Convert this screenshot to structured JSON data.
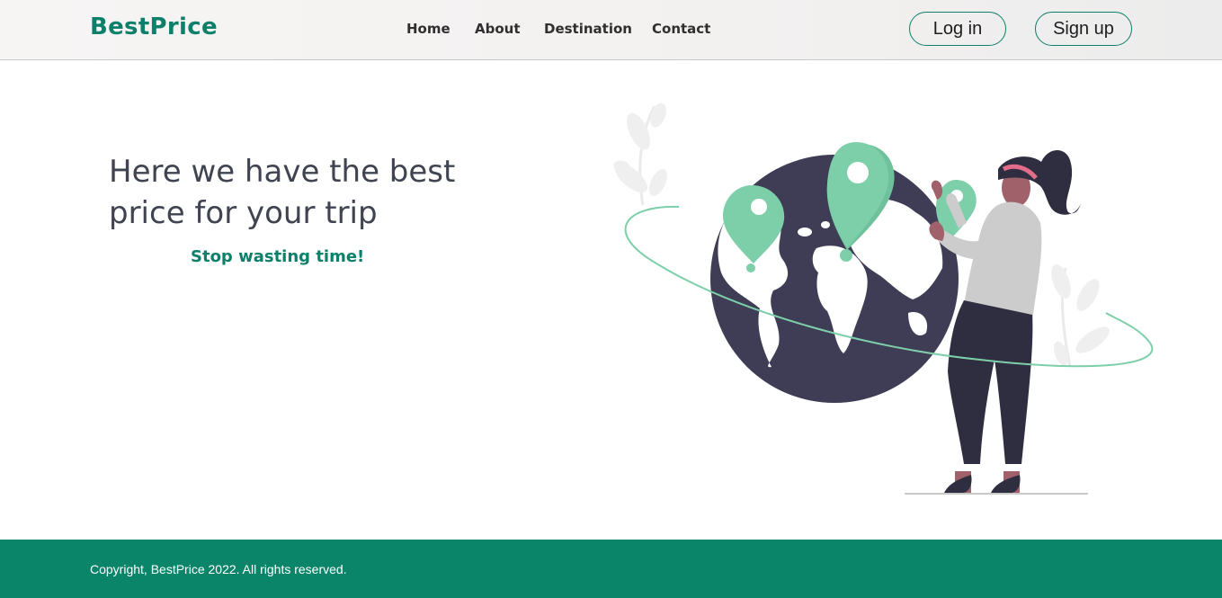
{
  "header": {
    "brand": "BestPrice",
    "nav": [
      "Home",
      "About",
      "Destination",
      "Contact"
    ],
    "login_label": "Log in",
    "signup_label": "Sign up"
  },
  "hero": {
    "title": "Here we have the best price for your trip",
    "subtitle": "Stop wasting time!"
  },
  "illustration": {
    "icon": "traveler-globe-illustration",
    "colors": {
      "globe": "#3f3d56",
      "pin": "#7dcfa9",
      "orbit": "#7dcfa9",
      "shirt": "#cccccc",
      "pants": "#2f2e41",
      "skin": "#a0616a",
      "headband": "#e26d8a",
      "leaves": "#f0f0f0"
    }
  },
  "footer": {
    "copyright": "Copyright, BestPrice 2022. All rights reserved."
  },
  "colors": {
    "brand": "#0c806a",
    "footer_bg": "#0a8569",
    "text_dark": "#3f4450"
  }
}
